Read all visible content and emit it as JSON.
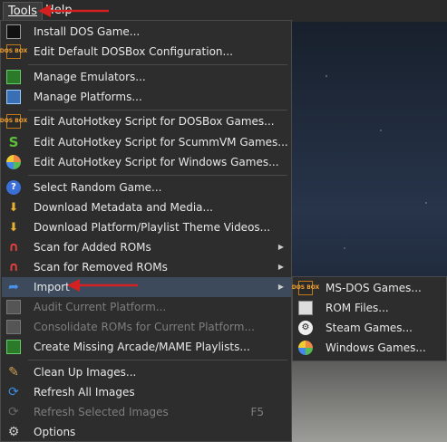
{
  "menubar": {
    "tools_label": "Tools",
    "help_label": "Help"
  },
  "tools_menu": {
    "items": [
      {
        "label": "Install DOS Game...",
        "icon": "terminal-icon"
      },
      {
        "label": "Edit Default DOSBox Configuration...",
        "icon": "dosbox-icon"
      },
      {
        "label": "Manage Emulators...",
        "icon": "chip-icon"
      },
      {
        "label": "Manage Platforms...",
        "icon": "monitor-icon"
      },
      {
        "label": "Edit AutoHotkey Script for DOSBox Games...",
        "icon": "dosbox-icon"
      },
      {
        "label": "Edit AutoHotkey Script for ScummVM Games...",
        "icon": "scummvm-icon"
      },
      {
        "label": "Edit AutoHotkey Script for Windows Games...",
        "icon": "windows-icon"
      },
      {
        "label": "Select Random Game...",
        "icon": "question-icon"
      },
      {
        "label": "Download Metadata and Media...",
        "icon": "download-icon"
      },
      {
        "label": "Download Platform/Playlist Theme Videos...",
        "icon": "download-icon"
      },
      {
        "label": "Scan for Added ROMs",
        "icon": "magnet-icon"
      },
      {
        "label": "Scan for Removed ROMs",
        "icon": "magnet-icon"
      },
      {
        "label": "Import",
        "icon": "import-icon"
      },
      {
        "label": "Audit Current Platform...",
        "icon": "audit-icon"
      },
      {
        "label": "Consolidate ROMs for Current Platform...",
        "icon": "consolidate-icon"
      },
      {
        "label": "Create Missing Arcade/MAME Playlists...",
        "icon": "playlist-icon"
      },
      {
        "label": "Clean Up Images...",
        "icon": "broom-icon"
      },
      {
        "label": "Refresh All Images",
        "icon": "refresh-icon"
      },
      {
        "label": "Refresh Selected Images",
        "icon": "refresh-icon",
        "shortcut": "F5"
      },
      {
        "label": "Options",
        "icon": "gear-icon"
      }
    ]
  },
  "import_submenu": {
    "items": [
      {
        "label": "MS-DOS Games...",
        "icon": "dosbox-icon"
      },
      {
        "label": "ROM Files...",
        "icon": "rom-icon"
      },
      {
        "label": "Steam Games...",
        "icon": "steam-icon"
      },
      {
        "label": "Windows Games...",
        "icon": "windows-icon"
      }
    ]
  },
  "dosbox_icon_text": "DOS BOX",
  "colors": {
    "menu_bg": "#2d2d2d",
    "highlight": "#3c4a5c",
    "annotation_arrow": "#d42020"
  }
}
